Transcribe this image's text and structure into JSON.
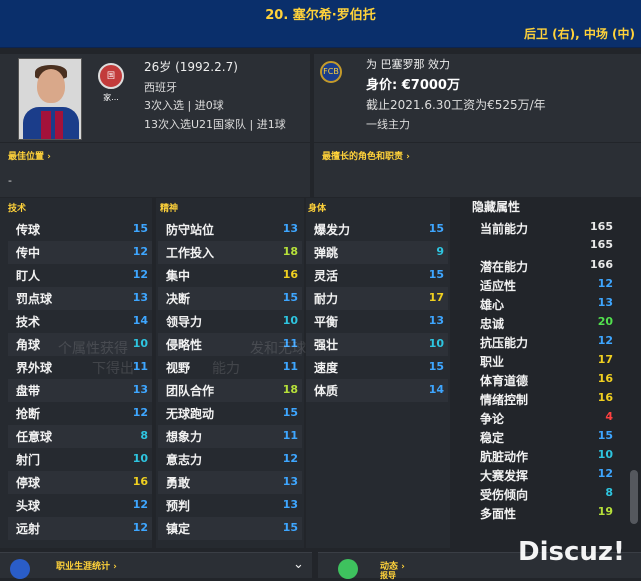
{
  "header": {
    "name": "20. 塞尔希·罗伯托",
    "positions": "后卫 (右), 中场 (中)"
  },
  "profile": {
    "flag_text": "国家...",
    "age": "26岁 (1992.2.7)",
    "nationality": "西班牙",
    "caps": "3次入选 | 进0球",
    "u21_caps": "13次入选U21国家队 | 进1球"
  },
  "club": {
    "playing_for": "为 巴塞罗那 效力",
    "value": "身价: €7000万",
    "contract": "截止2021.6.30工资为€525万/年",
    "squad_status": "一线主力",
    "crest_text": "FCB"
  },
  "best_position": {
    "title": "最佳位置 ›",
    "value": "-"
  },
  "best_roles": {
    "title": "最擅长的角色和职责 ›"
  },
  "technical": {
    "title": "技术",
    "items": [
      {
        "label": "传球",
        "value": "15"
      },
      {
        "label": "传中",
        "value": "12"
      },
      {
        "label": "盯人",
        "value": "12"
      },
      {
        "label": "罚点球",
        "value": "13"
      },
      {
        "label": "技术",
        "value": "14"
      },
      {
        "label": "角球",
        "value": "10"
      },
      {
        "label": "界外球",
        "value": "11"
      },
      {
        "label": "盘带",
        "value": "13"
      },
      {
        "label": "抢断",
        "value": "12"
      },
      {
        "label": "任意球",
        "value": "8"
      },
      {
        "label": "射门",
        "value": "10"
      },
      {
        "label": "停球",
        "value": "16"
      },
      {
        "label": "头球",
        "value": "12"
      },
      {
        "label": "远射",
        "value": "12"
      }
    ]
  },
  "mental": {
    "title": "精神",
    "items": [
      {
        "label": "防守站位",
        "value": "13"
      },
      {
        "label": "工作投入",
        "value": "18"
      },
      {
        "label": "集中",
        "value": "16"
      },
      {
        "label": "决断",
        "value": "15"
      },
      {
        "label": "领导力",
        "value": "10"
      },
      {
        "label": "侵略性",
        "value": "11"
      },
      {
        "label": "视野",
        "value": "11"
      },
      {
        "label": "团队合作",
        "value": "18"
      },
      {
        "label": "无球跑动",
        "value": "15"
      },
      {
        "label": "想象力",
        "value": "11"
      },
      {
        "label": "意志力",
        "value": "12"
      },
      {
        "label": "勇敢",
        "value": "13"
      },
      {
        "label": "预判",
        "value": "13"
      },
      {
        "label": "镇定",
        "value": "15"
      }
    ]
  },
  "physical": {
    "title": "身体",
    "items": [
      {
        "label": "爆发力",
        "value": "15"
      },
      {
        "label": "弹跳",
        "value": "9"
      },
      {
        "label": "灵活",
        "value": "15"
      },
      {
        "label": "耐力",
        "value": "17"
      },
      {
        "label": "平衡",
        "value": "13"
      },
      {
        "label": "强壮",
        "value": "10"
      },
      {
        "label": "速度",
        "value": "15"
      },
      {
        "label": "体质",
        "value": "14"
      }
    ]
  },
  "hidden": {
    "title": "隐藏属性",
    "current_ability_label": "当前能力",
    "current_ability": [
      "165",
      "165"
    ],
    "potential_label": "潜在能力",
    "potential": "166",
    "items": [
      {
        "label": "适应性",
        "value": "12"
      },
      {
        "label": "雄心",
        "value": "13"
      },
      {
        "label": "忠诚",
        "value": "20"
      },
      {
        "label": "抗压能力",
        "value": "12"
      },
      {
        "label": "职业",
        "value": "17"
      },
      {
        "label": "体育道德",
        "value": "16"
      },
      {
        "label": "情绪控制",
        "value": "16"
      },
      {
        "label": "争论",
        "value": "4"
      },
      {
        "label": "稳定",
        "value": "15"
      },
      {
        "label": "肮脏动作",
        "value": "10"
      },
      {
        "label": "大赛发挥",
        "value": "12"
      },
      {
        "label": "受伤倾向",
        "value": "8"
      },
      {
        "label": "多面性",
        "value": "19"
      }
    ]
  },
  "footer": {
    "career_stats": "职业生涯统计 ›",
    "news": "动态 ›",
    "news_sub": "报导"
  },
  "watermark": "Discuz!",
  "ghost_text": [
    "个属性获得",
    "发和无球",
    "下得出",
    "能力"
  ],
  "colors": {
    "header": "#0a2f6b",
    "accent": "#ffd23a"
  }
}
